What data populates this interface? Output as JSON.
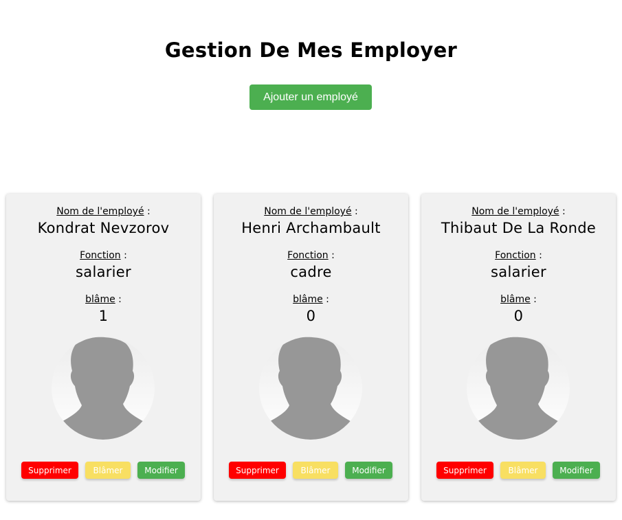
{
  "header": {
    "title": "Gestion De Mes Employer",
    "add_button_label": "Ajouter un employé"
  },
  "labels": {
    "name": "Nom de l'employé",
    "function": "Fonction",
    "blame": "blâme",
    "colon": " :"
  },
  "actions": {
    "delete": "Supprimer",
    "blame": "Blâmer",
    "edit": "Modifier"
  },
  "employees": [
    {
      "name": "Kondrat Nevzorov",
      "function": "salarier",
      "blame_count": "1",
      "avatar_icon": "default-user-silhouette"
    },
    {
      "name": "Henri Archambault",
      "function": "cadre",
      "blame_count": "0",
      "avatar_icon": "default-user-silhouette"
    },
    {
      "name": "Thibaut De La Ronde",
      "function": "salarier",
      "blame_count": "0",
      "avatar_icon": "default-user-silhouette"
    }
  ],
  "colors": {
    "add_button": "#4caf50",
    "delete_button": "#ff0000",
    "blame_button": "#f8df62",
    "edit_button": "#4caf50",
    "card_background": "#f1f1f1"
  }
}
